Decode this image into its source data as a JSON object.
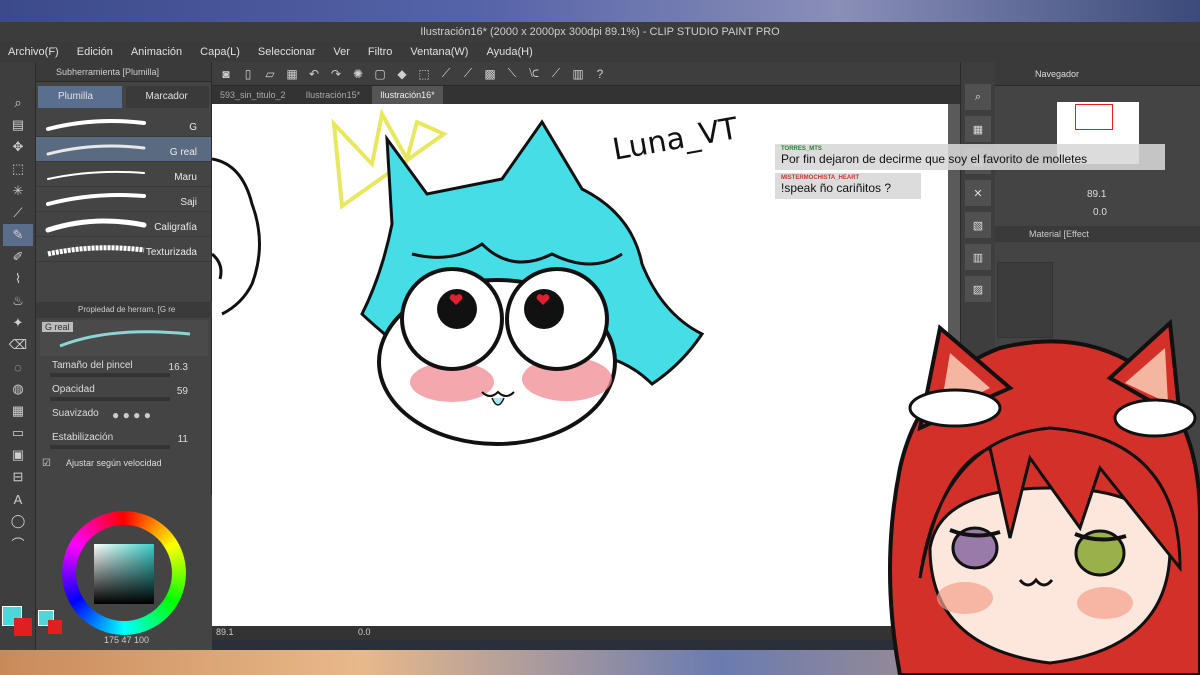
{
  "window": {
    "title": "Ilustración16* (2000 x 2000px 300dpi 89.1%)  - CLIP STUDIO PAINT PRO"
  },
  "menu": [
    "Archivo(F)",
    "Edición",
    "Animación",
    "Capa(L)",
    "Seleccionar",
    "Ver",
    "Filtro",
    "Ventana(W)",
    "Ayuda(H)"
  ],
  "subtool": {
    "header": "Subherramienta [Plumilla]",
    "tabs": [
      "Plumilla",
      "Marcador"
    ],
    "brushes": [
      {
        "label": "G"
      },
      {
        "label": "G real"
      },
      {
        "label": "Maru"
      },
      {
        "label": "Saji"
      },
      {
        "label": "Caligrafía"
      },
      {
        "label": "Texturizada"
      }
    ]
  },
  "properties": {
    "header": "Propiedad de herram. [G re",
    "preview_label": "G real",
    "brush_size_label": "Tamaño del pincel",
    "brush_size_value": "16.3",
    "opacity_label": "Opacidad",
    "opacity_value": "59",
    "smoothing_label": "Suavizado",
    "stabilization_label": "Estabilización",
    "stabilization_value": "11",
    "speed_adjust_label": "Ajustar según velocidad"
  },
  "color": {
    "values": "175  47  100",
    "main_color": "#4fd6d8",
    "sub_color": "#e02020"
  },
  "document_tabs": [
    "593_sin_titulo_2",
    "Ilustración15*",
    "Ilustración16*"
  ],
  "canvas": {
    "signature": "Luna_VT",
    "status_zoom": "89.1",
    "status_rotation": "0.0"
  },
  "navigator": {
    "header": "Navegador",
    "zoom": "89.1",
    "rotation": "0.0"
  },
  "material_panel": {
    "header": "Material [Effect"
  },
  "chat": [
    {
      "user": "TORRES_MTS",
      "user_color": "#2e7d32",
      "text": "Por fin dejaron de decirme que soy el favorito de molletes"
    },
    {
      "user": "MISTERMOCHISTA_HEART",
      "user_color": "#c0392b",
      "text": "!speak ño cariñitos ?"
    }
  ],
  "colors": {
    "drawing_cyan": "#45dde6",
    "blush": "#f08a90",
    "crown": "#f2f25a",
    "avatar_hair": "#d4302a"
  }
}
